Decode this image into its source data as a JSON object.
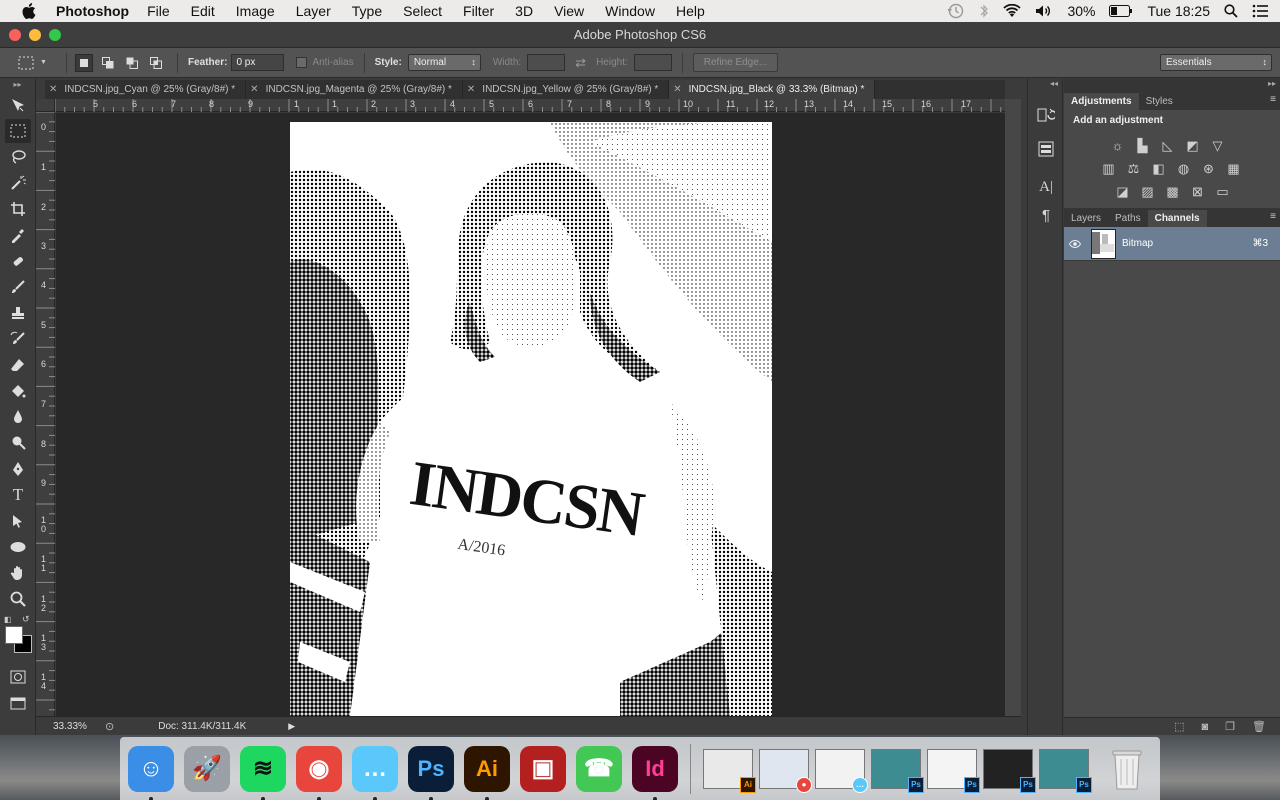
{
  "menubar": {
    "app_name": "Photoshop",
    "items": [
      "File",
      "Edit",
      "Image",
      "Layer",
      "Type",
      "Select",
      "Filter",
      "3D",
      "View",
      "Window",
      "Help"
    ],
    "battery": "30%",
    "clock": "Tue 18:25",
    "icons": [
      "apple-icon",
      "time-machine-icon",
      "bluetooth-icon",
      "wifi-icon",
      "volume-icon",
      "battery-icon",
      "spotlight-icon",
      "notification-list-icon"
    ]
  },
  "window": {
    "title": "Adobe Photoshop CS6",
    "traffic_colors": {
      "close": "#fc605b",
      "minimize": "#fdbc40",
      "zoom": "#34c84a"
    }
  },
  "options": {
    "feather_label": "Feather:",
    "feather_value": "0 px",
    "antialias_label": "Anti-alias",
    "style_label": "Style:",
    "style_value": "Normal",
    "width_label": "Width:",
    "height_label": "Height:",
    "refine_label": "Refine Edge...",
    "workspace_value": "Essentials"
  },
  "tabs": [
    {
      "label": "INDCSN.jpg_Cyan @ 25% (Gray/8#) *",
      "active": false
    },
    {
      "label": "INDCSN.jpg_Magenta @ 25% (Gray/8#) *",
      "active": false
    },
    {
      "label": "INDCSN.jpg_Yellow @ 25% (Gray/8#) *",
      "active": false
    },
    {
      "label": "INDCSN.jpg_Black @ 33.3% (Bitmap) *",
      "active": true
    }
  ],
  "ruler_top": [
    "5",
    "6",
    "7",
    "8",
    "9",
    "10",
    "1",
    "0",
    "1",
    "2",
    "3",
    "4",
    "5",
    "6",
    "7",
    "8",
    "9",
    "10",
    "11",
    "12",
    "13",
    "14",
    "15",
    "16",
    "17"
  ],
  "ruler_left": [
    "0",
    "1",
    "2",
    "3",
    "4",
    "5",
    "6",
    "7",
    "8",
    "9",
    "1 0",
    "1 1",
    "1 2",
    "1 3",
    "1 4"
  ],
  "image": {
    "shirt_text": "INDCSN",
    "shirt_year": "A/2016"
  },
  "status": {
    "zoom": "33.33%",
    "doc_info": "Doc: 311.4K/311.4K"
  },
  "adjustments": {
    "tabs": [
      "Adjustments",
      "Styles"
    ],
    "heading": "Add an adjustment"
  },
  "channels_panel": {
    "tabs": [
      "Layers",
      "Paths",
      "Channels"
    ],
    "rows": [
      {
        "name": "Bitmap",
        "shortcut": "⌘3"
      }
    ]
  },
  "dock": {
    "apps": [
      {
        "name": "Finder",
        "glyph": "☺",
        "bg": "#3a8ee6",
        "fg": "#ffffff"
      },
      {
        "name": "Launchpad",
        "glyph": "🚀",
        "bg": "#9aa0a6",
        "fg": "#333333"
      },
      {
        "name": "Spotify",
        "glyph": "≋",
        "bg": "#1ed760",
        "fg": "#111111"
      },
      {
        "name": "Chrome",
        "glyph": "◉",
        "bg": "#e8453c",
        "fg": "#ffffff"
      },
      {
        "name": "Messages",
        "glyph": "…",
        "bg": "#5ac8fa",
        "fg": "#ffffff"
      },
      {
        "name": "Photoshop",
        "glyph": "Ps",
        "bg": "#0b1e37",
        "fg": "#4fb3ff"
      },
      {
        "name": "Illustrator",
        "glyph": "Ai",
        "bg": "#2d1500",
        "fg": "#ff9a00"
      },
      {
        "name": "Photo Booth",
        "glyph": "▣",
        "bg": "#b3201f",
        "fg": "#ffffff"
      },
      {
        "name": "FaceTime",
        "glyph": "☎",
        "bg": "#43c755",
        "fg": "#ffffff"
      },
      {
        "name": "InDesign",
        "glyph": "Id",
        "bg": "#4b0423",
        "fg": "#ff3f94"
      }
    ]
  }
}
